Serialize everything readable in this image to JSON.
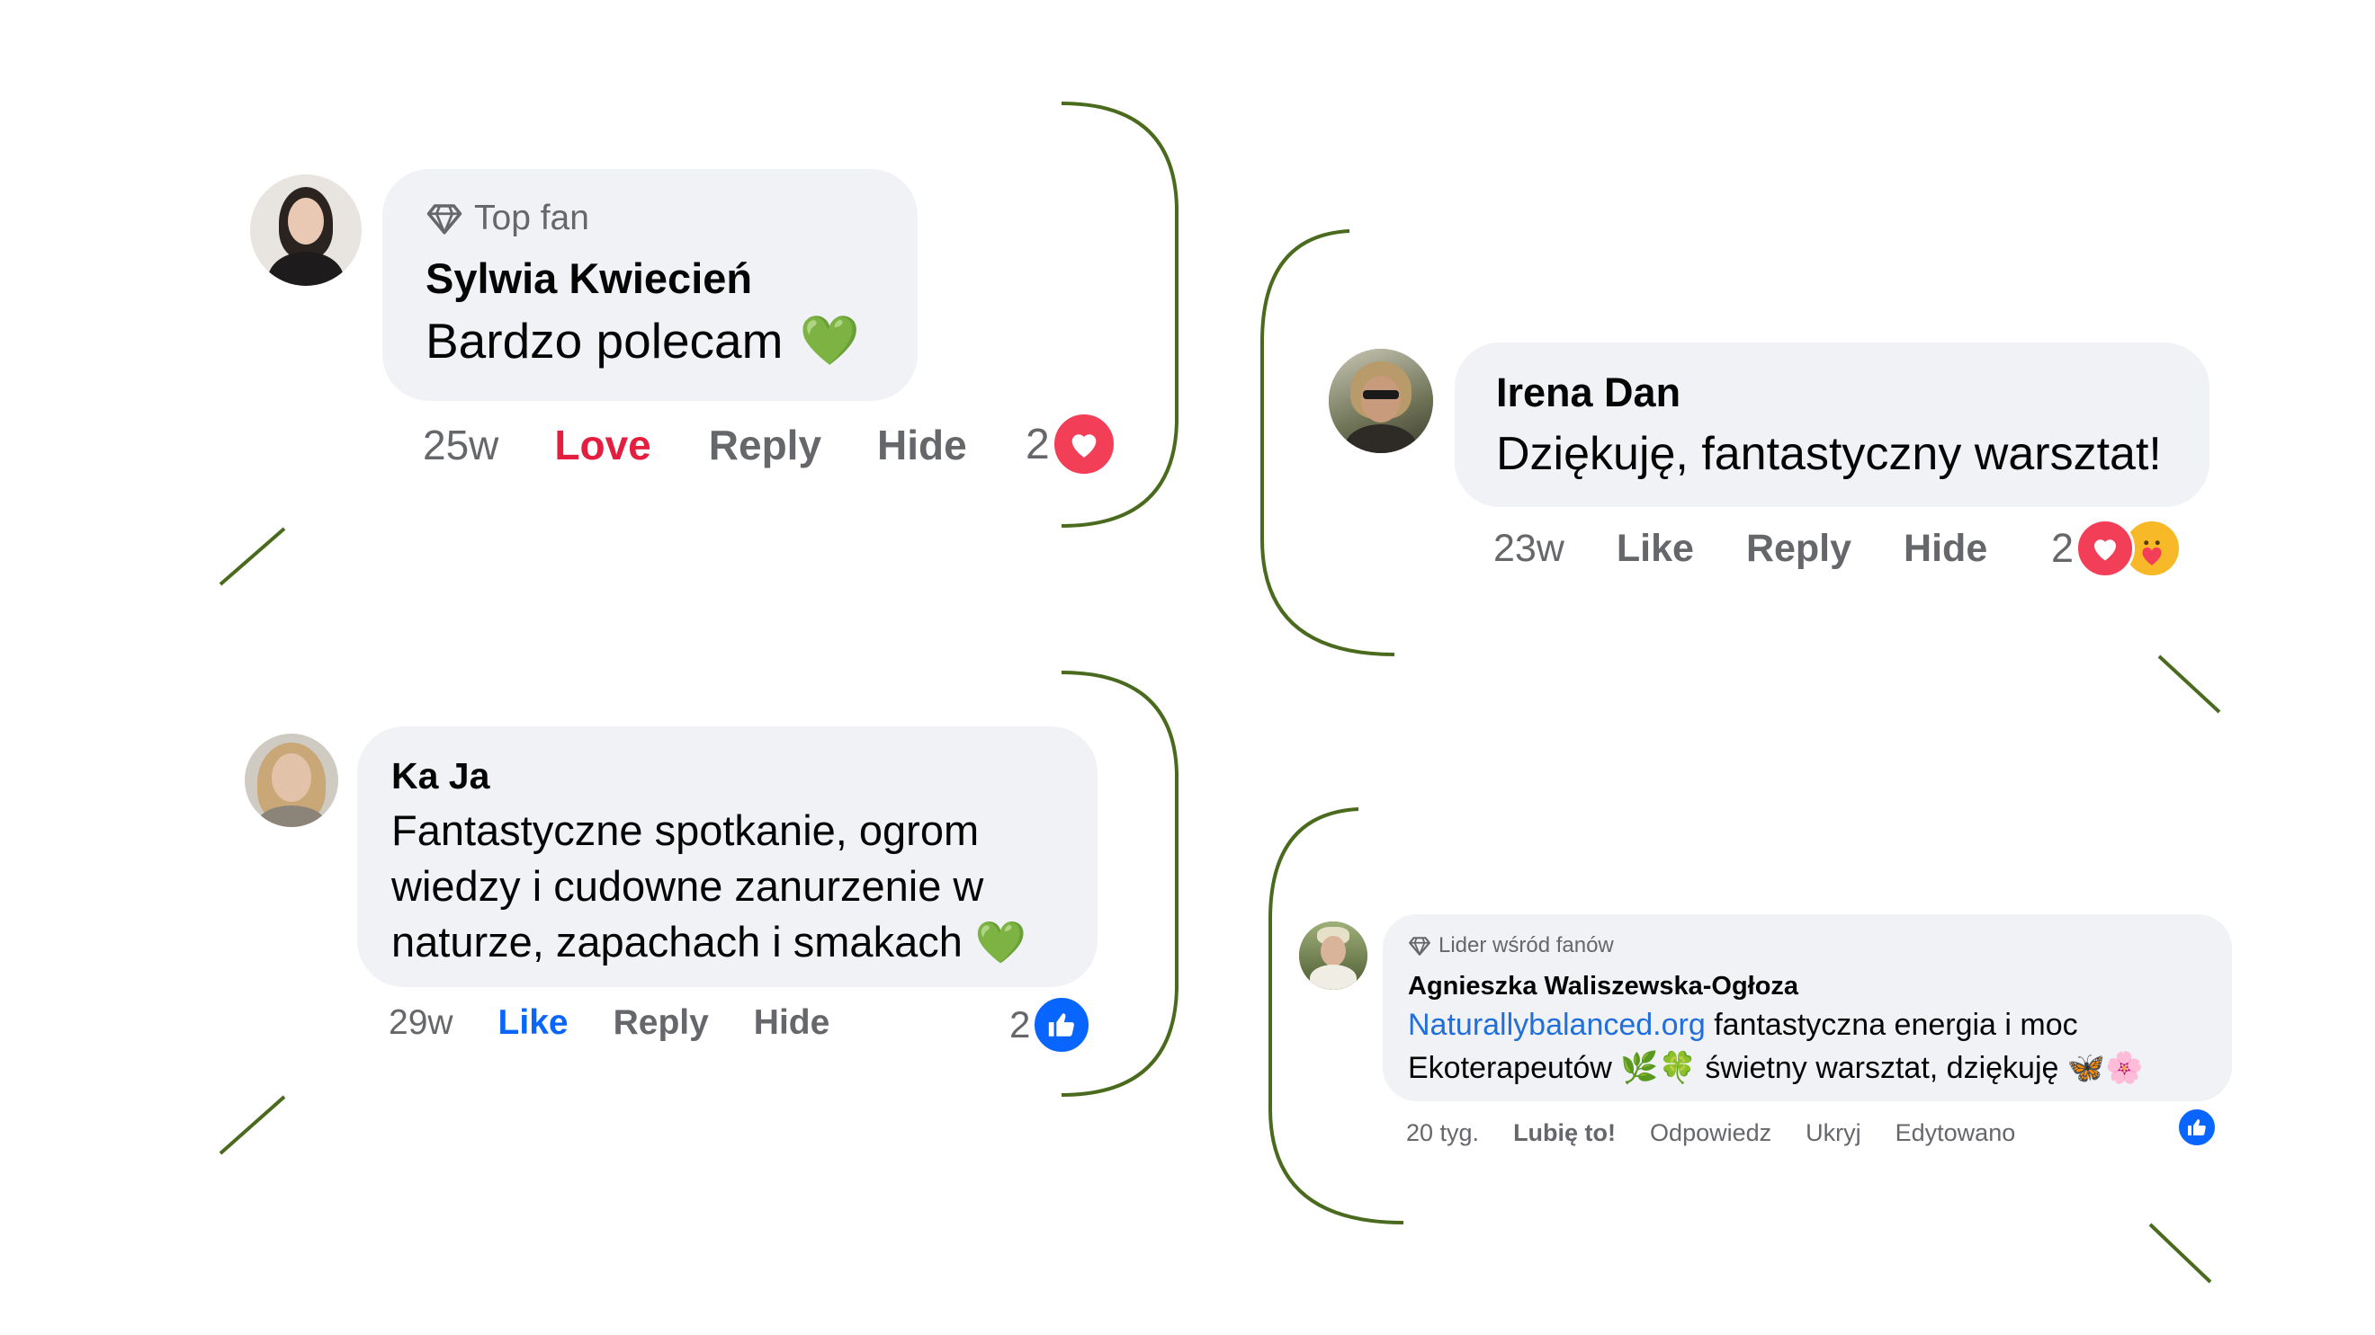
{
  "comments": [
    {
      "badge": "Top fan",
      "author": "Sylwia Kwiecień",
      "text": "Bardzo polecam",
      "emoji": "💚",
      "time": "25w",
      "reaction_action": "Love",
      "reply": "Reply",
      "hide": "Hide",
      "reaction_count": "2",
      "reaction_types": [
        "love"
      ]
    },
    {
      "author": "Irena Dan",
      "text": "Dziękuję, fantastyczny warsztat!",
      "time": "23w",
      "reaction_action": "Like",
      "reply": "Reply",
      "hide": "Hide",
      "reaction_count": "2",
      "reaction_types": [
        "love",
        "care"
      ]
    },
    {
      "author": "Ka Ja",
      "text_lines": [
        "Fantastyczne spotkanie, ogrom",
        "wiedzy i cudowne zanurzenie w",
        "naturze, zapachach i smakach"
      ],
      "emoji": "💚",
      "time": "29w",
      "reaction_action": "Like",
      "reply": "Reply",
      "hide": "Hide",
      "reaction_count": "2",
      "reaction_types": [
        "like"
      ]
    },
    {
      "badge": "Lider wśród fanów",
      "author": "Agnieszka Waliszewska-Ogłoza",
      "link": "Naturallybalanced.org",
      "text_line1": " fantastyczna energia i moc",
      "text_line2": "Ekoterapeutów",
      "emoji_a": "🌿🍀",
      "text_line2b": " świetny warsztat, dziękuję ",
      "emoji_b": "🦋🌸",
      "time": "20 tyg.",
      "reaction_action": "Lubię to!",
      "reply": "Odpowiedz",
      "hide": "Ukryj",
      "edited": "Edytowano",
      "reaction_types": [
        "like"
      ]
    }
  ],
  "colors": {
    "frame": "#4a6a1e",
    "bubble": "#f0f2f5",
    "secondary_text": "#65676b",
    "love_red": "#e41e3f",
    "like_blue": "#0866ff",
    "link_blue": "#216fdb"
  },
  "icons": [
    "diamond-icon",
    "love-reaction-icon",
    "care-reaction-icon",
    "like-reaction-icon",
    "green-heart-emoji"
  ]
}
